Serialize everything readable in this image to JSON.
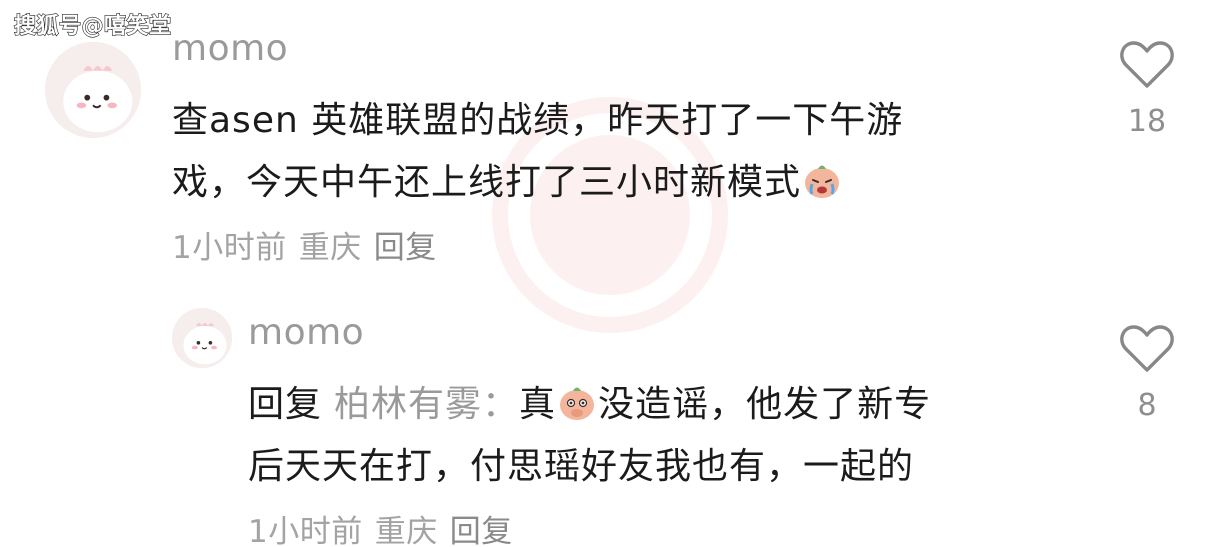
{
  "watermark": "搜狐号@嘻笑堂",
  "comments": [
    {
      "username": "momo",
      "line1": "查asen 英雄联盟的战绩，昨天打了一下午游",
      "line2": "戏，今天中午还上线打了三小时新模式",
      "emoji": "crying-face-emoji",
      "time": "1小时前",
      "location": "重庆",
      "reply_label": "回复",
      "likes": "18"
    },
    {
      "username": "momo",
      "reply_prefix": "回复",
      "reply_target": "柏林有雾",
      "reply_colon": "：",
      "line1_a": "真",
      "emoji": "thinking-face-emoji",
      "line1_b": "没造谣，他发了新专",
      "line2": "后天天在打，付思瑶好友我也有，一起的",
      "time": "1小时前",
      "location": "重庆",
      "reply_label": "回复",
      "likes": "8"
    }
  ],
  "colors": {
    "text": "#1b1b1b",
    "muted": "#9a9a9a",
    "avatar_bg": "#f6eded",
    "accent_pink": "#f08f8f"
  }
}
